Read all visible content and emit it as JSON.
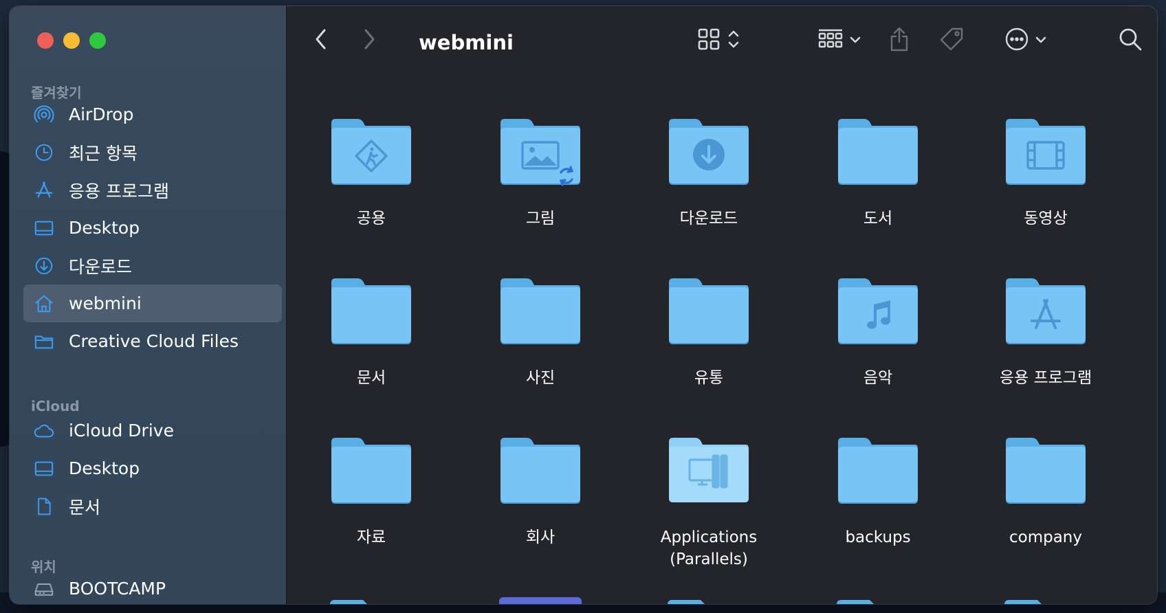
{
  "window": {
    "title": "webmini"
  },
  "sidebar": {
    "sections": [
      {
        "title": "즐겨찾기",
        "items": [
          {
            "label": "AirDrop",
            "icon": "airdrop-icon"
          },
          {
            "label": "최근 항목",
            "icon": "clock-icon"
          },
          {
            "label": "응용 프로그램",
            "icon": "applications-icon"
          },
          {
            "label": "Desktop",
            "icon": "desktop-icon"
          },
          {
            "label": "다운로드",
            "icon": "download-icon"
          },
          {
            "label": "webmini",
            "icon": "home-icon",
            "selected": true
          },
          {
            "label": "Creative Cloud Files",
            "icon": "folder-icon"
          }
        ]
      },
      {
        "title": "iCloud",
        "items": [
          {
            "label": "iCloud Drive",
            "icon": "cloud-icon"
          },
          {
            "label": "Desktop",
            "icon": "desktop-icon"
          },
          {
            "label": "문서",
            "icon": "document-icon"
          }
        ]
      },
      {
        "title": "위치",
        "items": [
          {
            "label": "BOOTCAMP",
            "icon": "drive-icon"
          }
        ]
      }
    ]
  },
  "toolbar": {
    "back": "chevron-left-icon",
    "forward": "chevron-right-icon",
    "view": "grid-view-icon",
    "group": "group-icon",
    "share": "share-icon",
    "tag": "tag-icon",
    "more": "ellipsis-circle-icon",
    "search": "search-icon"
  },
  "files": [
    {
      "name": "공용",
      "glyph": "public-icon"
    },
    {
      "name": "그림",
      "glyph": "pictures-icon",
      "syncing": true
    },
    {
      "name": "다운로드",
      "glyph": "download-icon"
    },
    {
      "name": "도서",
      "glyph": "none"
    },
    {
      "name": "동영상",
      "glyph": "movies-icon"
    },
    {
      "name": "문서",
      "glyph": "none"
    },
    {
      "name": "사진",
      "glyph": "none"
    },
    {
      "name": "유통",
      "glyph": "none"
    },
    {
      "name": "음악",
      "glyph": "music-icon"
    },
    {
      "name": "응용 프로그램",
      "glyph": "applications-icon"
    },
    {
      "name": "자료",
      "glyph": "none"
    },
    {
      "name": "회사",
      "glyph": "none"
    },
    {
      "name": "Applications (Parallels)",
      "glyph": "parallels-icon"
    },
    {
      "name": "backups",
      "glyph": "none"
    },
    {
      "name": "company",
      "glyph": "none"
    }
  ],
  "colors": {
    "folder": "#6cbcf0",
    "folder_top": "#5aaee6",
    "glyph": "#4a97d4",
    "accent": "#1d9bf0"
  }
}
